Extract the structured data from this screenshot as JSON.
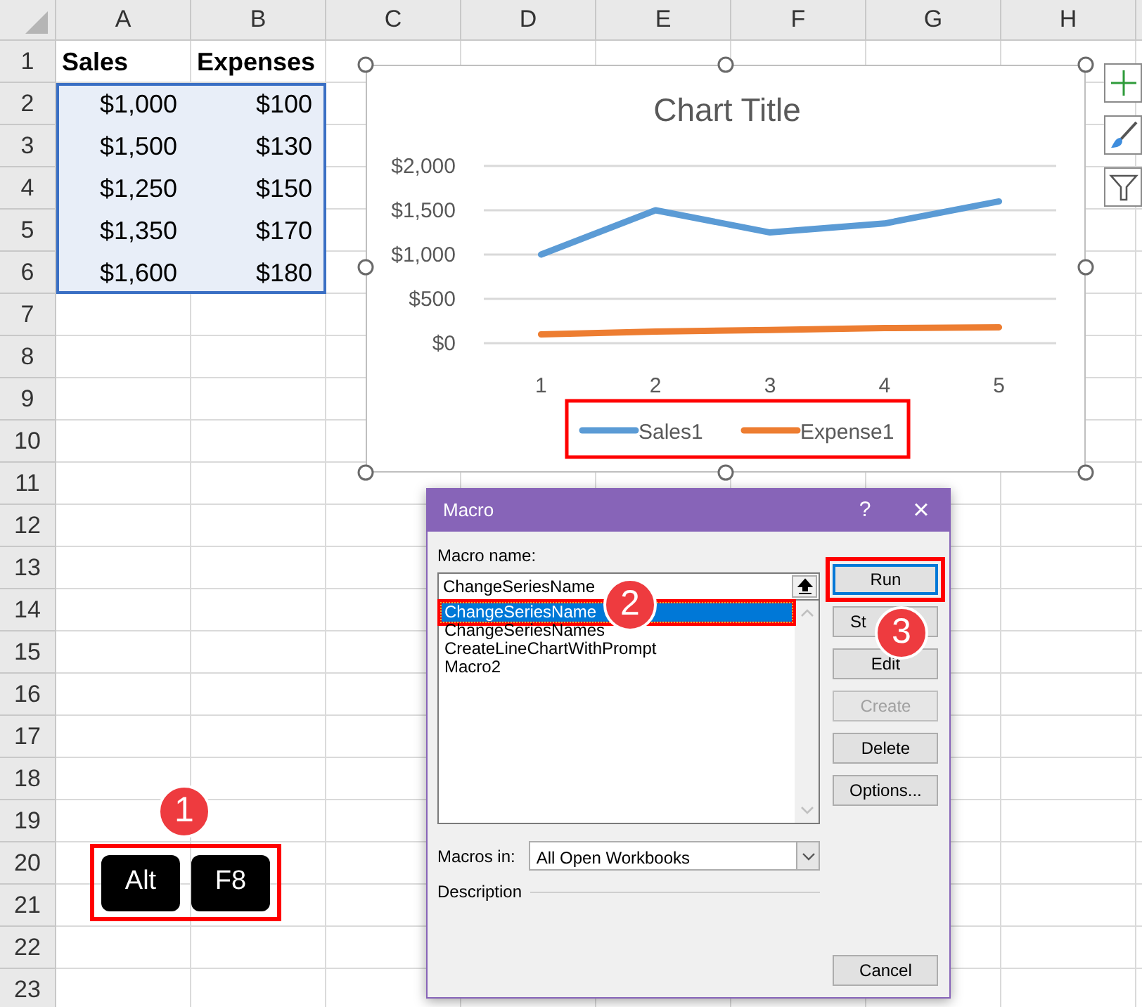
{
  "sheet": {
    "columns": [
      "A",
      "B",
      "C",
      "D",
      "E",
      "F",
      "G",
      "H"
    ],
    "rows": [
      {
        "header": "1",
        "kind": "label",
        "cells": [
          {
            "text": "Sales",
            "selected": false
          },
          {
            "text": "Expenses",
            "selected": false
          }
        ]
      },
      {
        "header": "2",
        "kind": "value",
        "cells": [
          {
            "text": "$1,000",
            "selected": true
          },
          {
            "text": "$100",
            "selected": true
          }
        ]
      },
      {
        "header": "3",
        "kind": "value",
        "cells": [
          {
            "text": "$1,500",
            "selected": true
          },
          {
            "text": "$130",
            "selected": true
          }
        ]
      },
      {
        "header": "4",
        "kind": "value",
        "cells": [
          {
            "text": "$1,250",
            "selected": true
          },
          {
            "text": "$150",
            "selected": true
          }
        ]
      },
      {
        "header": "5",
        "kind": "value",
        "cells": [
          {
            "text": "$1,350",
            "selected": true
          },
          {
            "text": "$170",
            "selected": true
          }
        ]
      },
      {
        "header": "6",
        "kind": "value",
        "cells": [
          {
            "text": "$1,600",
            "selected": true
          },
          {
            "text": "$180",
            "selected": true
          }
        ]
      },
      {
        "header": "7"
      },
      {
        "header": "8"
      },
      {
        "header": "9"
      },
      {
        "header": "10"
      },
      {
        "header": "11"
      },
      {
        "header": "12"
      },
      {
        "header": "13"
      },
      {
        "header": "14"
      },
      {
        "header": "15"
      },
      {
        "header": "16"
      },
      {
        "header": "17"
      },
      {
        "header": "18"
      },
      {
        "header": "19"
      },
      {
        "header": "20"
      },
      {
        "header": "21"
      },
      {
        "header": "22"
      },
      {
        "header": "23"
      }
    ]
  },
  "chart": {
    "legend_highlighted": true,
    "chart_data": {
      "type": "line",
      "title": "Chart Title",
      "grid": true,
      "legend": true,
      "categories": [
        "1",
        "2",
        "3",
        "4",
        "5"
      ],
      "series": [
        {
          "name": "Sales1",
          "color": "#5b9bd5",
          "values": [
            1000,
            1500,
            1250,
            1350,
            1600
          ]
        },
        {
          "name": "Expense1",
          "color": "#ed7d31",
          "values": [
            100,
            130,
            150,
            170,
            180
          ]
        }
      ],
      "ylim": [
        0,
        2000
      ],
      "yticks": [
        {
          "value": 0,
          "label": "$0"
        },
        {
          "value": 500,
          "label": "$500"
        },
        {
          "value": 1000,
          "label": "$1,000"
        },
        {
          "value": 1500,
          "label": "$1,500"
        },
        {
          "value": 2000,
          "label": "$2,000"
        }
      ]
    }
  },
  "keys": {
    "highlighted": true,
    "items": [
      "Alt",
      "F8"
    ]
  },
  "callouts": [
    {
      "text": "1"
    },
    {
      "text": "2"
    },
    {
      "text": "3"
    }
  ],
  "dialog": {
    "title": "Macro",
    "help": "?",
    "close": "×",
    "name_label": "Macro name:",
    "name_value": "ChangeSeriesName",
    "macros": [
      {
        "name": "ChangeSeriesName",
        "selected": true,
        "highlighted": true
      },
      {
        "name": "ChangeSeriesNames",
        "selected": false,
        "highlighted": false
      },
      {
        "name": "CreateLineChartWithPrompt",
        "selected": false,
        "highlighted": false
      },
      {
        "name": "Macro2",
        "selected": false,
        "highlighted": false
      }
    ],
    "buttons": [
      {
        "label": "Run",
        "kind": "side",
        "default": true,
        "disabled": false,
        "highlighted": true
      },
      {
        "label": "St",
        "kind": "partial",
        "default": false,
        "disabled": false
      },
      {
        "label": "Edit",
        "kind": "side",
        "default": false,
        "disabled": false
      },
      {
        "label": "Create",
        "kind": "side",
        "default": false,
        "disabled": true
      },
      {
        "label": "Delete",
        "kind": "side",
        "default": false,
        "disabled": false
      },
      {
        "label": "Options...",
        "kind": "side",
        "default": false,
        "disabled": false
      },
      {
        "label": "Cancel",
        "kind": "bottom",
        "default": false,
        "disabled": false
      }
    ],
    "macros_in_label": "Macros in:",
    "macros_in_value": "All Open Workbooks",
    "description_label": "Description"
  }
}
